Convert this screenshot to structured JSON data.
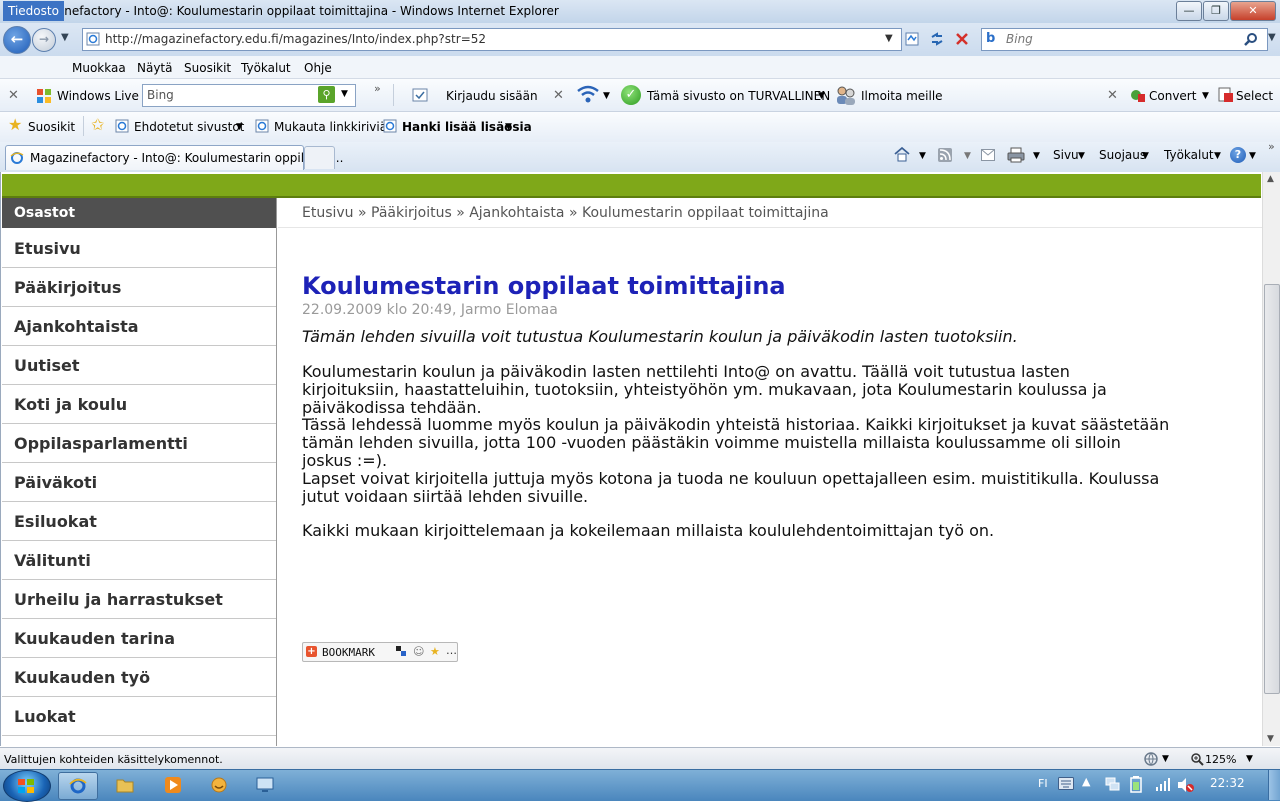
{
  "window": {
    "title": "Magazinefactory - Into@: Koulumestarin oppilaat toimittajina - Windows Internet Explorer",
    "minimize": "—",
    "maximize": "❐",
    "close": "✕"
  },
  "address": {
    "url": "http://magazinefactory.edu.fi/magazines/Into/index.php?str=52",
    "search_placeholder": "Bing"
  },
  "menu": [
    "Tiedosto",
    "Muokkaa",
    "Näytä",
    "Suosikit",
    "Työkalut",
    "Ohje"
  ],
  "toolbar1": {
    "windows_live": "Windows Live",
    "bing_placeholder": "Bing",
    "login": "Kirjaudu sisään",
    "safe": "Tämä sivusto on TURVALLINEN",
    "report": "Ilmoita meille",
    "convert": "Convert",
    "select": "Select"
  },
  "favorites_bar": {
    "favorites": "Suosikit",
    "suggested": "Ehdotetut sivustot",
    "customize": "Mukauta linkkiriviä",
    "addons": "Hanki lisää lisäosia"
  },
  "tab": {
    "label": "Magazinefactory - Into@: Koulumestarin oppilaat t..."
  },
  "command_bar": {
    "page": "Sivu",
    "safety": "Suojaus",
    "tools": "Työkalut"
  },
  "sidebar": {
    "header": "Osastot",
    "items": [
      "Etusivu",
      "Pääkirjoitus",
      "Ajankohtaista",
      "Uutiset",
      "Koti ja koulu",
      "Oppilasparlamentti",
      "Päiväkoti",
      "Esiluokat",
      "Välitunti",
      "Urheilu ja harrastukset",
      "Kuukauden tarina",
      "Kuukauden työ",
      "Luokat"
    ]
  },
  "breadcrumb": "Etusivu » Pääkirjoitus » Ajankohtaista » Koulumestarin oppilaat toimittajina",
  "article": {
    "title": "Koulumestarin oppilaat toimittajina",
    "meta": "22.09.2009 klo 20:49, Jarmo Elomaa",
    "lead": "Tämän lehden sivuilla voit tutustua Koulumestarin koulun ja päiväkodin lasten tuotoksiin.",
    "paragraphs": [
      "Koulumestarin koulun  ja päiväkodin lasten nettilehti Into@ on avattu. Täällä voit tutustua lasten kirjoituksiin, haastatteluihin, tuotoksiin, yhteistyöhön ym. mukavaan, jota Koulumestarin koulussa ja päiväkodissa tehdään.",
      "Tässä lehdessä luomme myös koulun ja päiväkodin yhteistä historiaa. Kaikki kirjoitukset ja kuvat säästetään tämän lehden sivuilla, jotta 100 -vuoden päästäkin voimme muistella millaista koulussamme oli silloin joskus :=).",
      "Lapset voivat kirjoitella juttuja myös kotona ja tuoda ne kouluun opettajalleen esim. muistitikulla. Koulussa jutut voidaan siirtää lehden sivuille.",
      "Kaikki mukaan kirjoittelemaan ja kokeilemaan millaista koululehdentoimittajan työ on."
    ],
    "bookmark": "BOOKMARK"
  },
  "status": {
    "text": "Valittujen kohteiden käsittelykomennot.",
    "zoom": "125%"
  },
  "taskbar": {
    "lang": "FI",
    "clock": "22:32"
  },
  "colors": {
    "green_bar": "#7fa819",
    "title_blue": "#1d22b7",
    "sidebar_header": "#505050"
  }
}
